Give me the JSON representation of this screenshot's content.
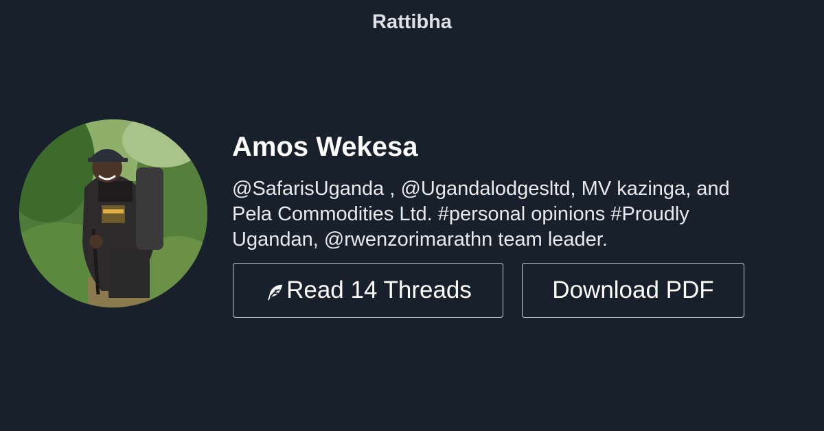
{
  "header": {
    "brand": "Rattibha"
  },
  "profile": {
    "avatar_icon": "profile-photo",
    "name": "Amos Wekesa",
    "bio_lines": [
      "@SafarisUganda , @Ugandalodgesltd, MV kazinga, and",
      "Pela Commodities Ltd. #personal opinions #Proudly",
      "Ugandan, @rwenzorimarathn team leader."
    ]
  },
  "actions": {
    "read_label": "Read 14 Threads",
    "read_icon": "feather-icon",
    "pdf_label": "Download PDF"
  },
  "colors": {
    "background": "#18202b",
    "button_border": "#c9ced6",
    "text": "#ffffff"
  }
}
